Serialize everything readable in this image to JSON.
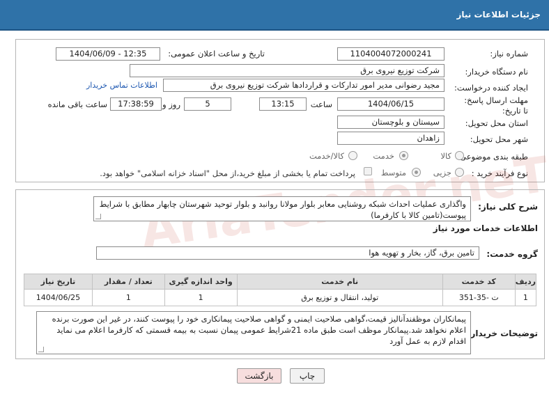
{
  "header": {
    "title": "جزئیات اطلاعات نیاز"
  },
  "form": {
    "need_number_label": "شماره نیاز:",
    "need_number": "1104004072000241",
    "announce_label": "تاریخ و ساعت اعلان عمومی:",
    "announce_value": "1404/06/09 - 12:35",
    "buyer_label": "نام دستگاه خریدار:",
    "buyer_value": "شرکت توزیع نیروی برق",
    "creator_label": "ایجاد کننده درخواست:",
    "creator_value": "مجید  رضوانی مدیر امور تدارکات و قراردادها شرکت توزیع نیروی برق",
    "contact_link": "اطلاعات تماس خریدار",
    "deadline_label": "مهلت ارسال پاسخ: تا تاریخ:",
    "deadline_date": "1404/06/15",
    "time_label": "ساعت",
    "deadline_time": "13:15",
    "days_value": "5",
    "days_label": "روز و",
    "remaining_time": "17:38:59",
    "remaining_label": "ساعت باقی مانده",
    "province_label": "استان محل تحویل:",
    "province_value": "سیستان و بلوچستان",
    "city_label": "شهر محل تحویل:",
    "city_value": "زاهدان",
    "category_label": "طبقه بندی موضوعی:",
    "category_options": [
      "کالا",
      "خدمت",
      "کالا/خدمت"
    ],
    "category_selected": "خدمت",
    "process_label": "نوع فرآیند خرید :",
    "process_options": [
      "جزیی",
      "متوسط"
    ],
    "process_selected": "متوسط",
    "payment_note": "پرداخت تمام یا بخشی از مبلغ خرید،از محل \"اسناد خزانه اسلامی\" خواهد بود."
  },
  "summary": {
    "label": "شرح کلی نیاز:",
    "text": "واگذاری عملیات احداث شبکه روشنایی معابر بلوار مولانا روانبد و بلوار توحید شهرستان چابهار مطابق با شرایط پیوست(تامین کالا با کارفرما)"
  },
  "services": {
    "section_title": "اطلاعات خدمات مورد نیاز",
    "group_label": "گروه خدمت:",
    "group_value": "تامین برق، گاز، بخار و تهویه هوا",
    "columns": [
      "ردیف",
      "کد خدمت",
      "نام خدمت",
      "واحد اندازه گیری",
      "تعداد / مقدار",
      "تاریخ نیاز"
    ],
    "rows": [
      [
        "1",
        "ت -35-351",
        "تولید، انتقال و توزیع برق",
        "1",
        "1",
        "1404/06/25"
      ]
    ]
  },
  "buyer_notes": {
    "label": "توضیحات خریدار:",
    "text": "پیمانکاران موظفندآنالیز قیمت،گواهی صلاحیت ایمنی و گواهی صلاحیت پیمانکاری خود را پیوست کنند، در غیر این صورت برنده اعلام نخواهد شد.پیمانکار موظف است طبق ماده 21شرایط عمومی پیمان نسبت به بیمه قسمتی که کارفرما اعلام می نماید اقدام لازم به عمل آورد"
  },
  "buttons": {
    "print": "چاپ",
    "back": "بازگشت"
  },
  "watermark": "AriaTender.neT",
  "colors": {
    "header": "#2f72a8",
    "link": "#1a55b0",
    "back_button": "#f7dede"
  }
}
